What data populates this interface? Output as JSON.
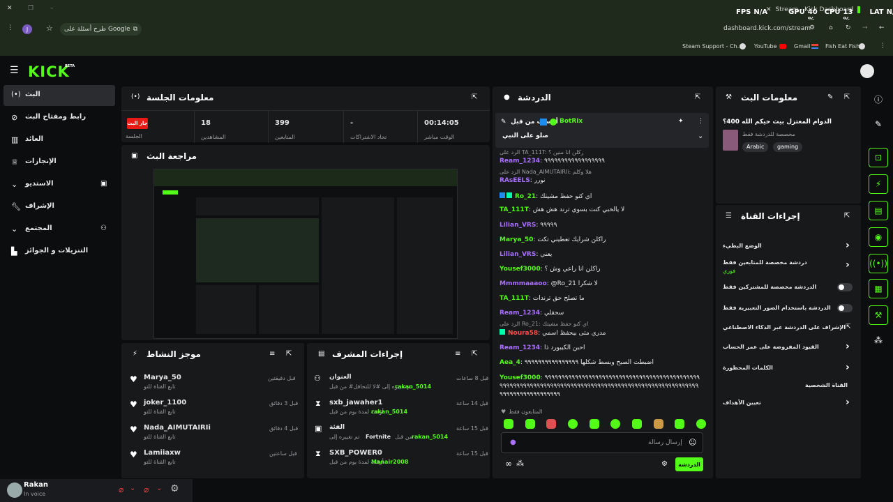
{
  "browser": {
    "tab_title": "Stream - Kick Dashboard",
    "overlay": {
      "fps_label": "FPS",
      "fps": "N/A",
      "gpu_label": "GPU",
      "gpu": "40 %",
      "cpu_label": "CPU",
      "cpu": "13 %",
      "lat_label": "LAT",
      "lat": "N/A"
    },
    "profile_initial": "J",
    "search_chip": "طرح أسئلة على Google",
    "url": "dashboard.kick.com/stream",
    "bookmarks": [
      "Steam Support - Ch...",
      "YouTube",
      "Gmail",
      "Fish Eat Fish"
    ]
  },
  "kick": {
    "logo": "KICK",
    "beta": "BETA"
  },
  "sidebar": {
    "items": [
      {
        "label": "البث",
        "icon": "broadcast-icon"
      },
      {
        "label": "رابط ومفتاح البث",
        "icon": "link-icon"
      },
      {
        "label": "العائد",
        "icon": "chart-icon"
      },
      {
        "label": "الإنجازات",
        "icon": "trophy-icon"
      },
      {
        "label": "الاستديو",
        "icon": "studio-icon"
      },
      {
        "label": "الإشراف",
        "icon": "wrench-icon"
      },
      {
        "label": "المجتمع",
        "icon": "community-icon"
      },
      {
        "label": "التنزيلات و الجوائز",
        "icon": "drops-icon"
      }
    ]
  },
  "session": {
    "title": "معلومات الجلسة",
    "live_badge": "جار البث",
    "live_label": "الجلسة",
    "stats": [
      {
        "value": "18",
        "label": "المشاهدين"
      },
      {
        "value": "399",
        "label": "المتابعين"
      },
      {
        "value": "-",
        "label": "تحاد الاشتراكات"
      },
      {
        "value": "00:14:05",
        "label": "الوقت مباشر"
      }
    ]
  },
  "preview": {
    "title": "مراجعة البث"
  },
  "activity": {
    "title": "موجز النشاط",
    "items": [
      {
        "name": "Marya_50",
        "sub": "تابع القناة للتو",
        "time": "قبل دقيقتين"
      },
      {
        "name": "joker_1100",
        "sub": "تابع القناة للتو",
        "time": "قبل 3 دقائق"
      },
      {
        "name": "Nada_AIMUTAIRIi",
        "sub": "تابع القناة للتو",
        "time": "قبل 4 دقائق"
      },
      {
        "name": "Lamiiaxw",
        "sub": "تابع القناة للتو",
        "time": "قبل ساعتين"
      }
    ]
  },
  "modactions": {
    "title": "إجراءات المشرف",
    "items": [
      {
        "title": "العنوان",
        "sub": "تم تغييره إلى #لا للتحاقل# من قبل",
        "user": "rakan_5014",
        "time": "قبل 8 ساعات"
      },
      {
        "title": "sxb_jawaher1",
        "sub": "أوقف لمدة يوم من قبل",
        "user": "rakan_5014",
        "time": "قبل 14 ساعة"
      },
      {
        "title": "الفئة",
        "sub": "تم تغييره إلى",
        "extra": "Fortnite",
        "sub2": "من قبل",
        "user": "rakan_5014",
        "time": "قبل 15 ساعة"
      },
      {
        "title": "SXB_POWER0",
        "sub": "أوقف لمدة يوم من قبل",
        "user": "Manair2008",
        "time": "قبل 15 ساعة"
      }
    ]
  },
  "chat": {
    "title": "الدردشة",
    "pinned_by": "أرسلت من قبل",
    "pinned_user": "BotRix",
    "pinned_msg": "صلو على النبي",
    "messages": [
      {
        "reply": "الرد على TA_111T: ركلن انا منين ؟",
        "user": "Ream_1234",
        "color": "purple",
        "text": "٩٩٩٩٩٩٩٩٩٩٩٩٩٩٩٩٩٩"
      },
      {
        "reply": "الرد على Nada_AIMUTAIRIi: هلا وكلم",
        "user": "RAsEELS",
        "color": "purple",
        "text": "نورر"
      },
      {
        "user": "Ro_21",
        "color": "green",
        "text": "اي كنو حفظ مشيتك"
      },
      {
        "user": "TA_111T",
        "color": "green",
        "text": "لا يالخبي كنت بسوي ترند هش هش"
      },
      {
        "user": "Lilian_VRS",
        "color": "purple",
        "text": "٩٩٩٩٩"
      },
      {
        "user": "Marya_50",
        "color": "green",
        "text": "راكلن شرايك تعطيني تكت"
      },
      {
        "user": "Lilian_VRS",
        "color": "purple",
        "text": "يعني"
      },
      {
        "user": "Yousef3000",
        "color": "green",
        "text": "راكلن انا راعي وش ؟"
      },
      {
        "user": "Mmmmaaaoo",
        "color": "purple",
        "text": "@Ro_21 لا شكرا"
      },
      {
        "user": "TA_111T",
        "color": "green",
        "text": "ما تصلح حق ترندات"
      },
      {
        "user": "Ream_1234",
        "color": "purple",
        "text": "سحقلي"
      },
      {
        "reply": "الرد على Ro_21: اي كنو حفظ مشيتك",
        "user": "Noura58",
        "color": "red",
        "text": "مدري متى بيحفظ اسمي"
      },
      {
        "user": "Ream_1234",
        "color": "purple",
        "text": "احبن الكيبورد ذا"
      },
      {
        "user": "Aea_4",
        "color": "green",
        "text": "اضبطت الصبح وبسط شكلها ٩٩٩٩٩٩٩٩٩٩٩٩٩٩٩٩"
      },
      {
        "user": "Yousef3000",
        "color": "green",
        "text": "٩٩٩٩٩٩٩٩٩٩٩٩٩٩٩٩٩٩٩٩٩٩٩٩٩٩٩٩٩٩٩٩٩٩٩٩٩٩٩٩٩٩٩٩٩٩٩٩٩٩٩٩٩٩٩٩٩٩٩٩٩٩٩٩٩٩٩٩٩٩٩٩٩٩٩٩٩٩٩٩٩٩٩٩٩٩٩٩٩٩٩٩٩٩٩٩٩٩٩٩٩٩٩٩٩٩٩٩٩٩٩٩٩٩٩٩٩٩٩٩٩٩٩"
      }
    ],
    "followers_only": "المتابعون فقط",
    "input_placeholder": "إرسال رسالة",
    "send_button": "الدردشة"
  },
  "streaminfo": {
    "title": "معلومات البث",
    "stream_title": "الدوام المعتزل بيث حيكم الله 400؟",
    "category": "مخصصة للدردشة فقط",
    "tags": [
      "Arabic",
      "gaming"
    ]
  },
  "channelactions": {
    "title": "إجراءات القناة",
    "items": [
      {
        "label": "الوضع البطيء",
        "type": "chev"
      },
      {
        "label": "دردشة مخصصة للمتابعين فقط",
        "sub": "فوري",
        "type": "chev"
      },
      {
        "label": "الدردشة مخصصة للمشتركين فقط",
        "type": "toggle"
      },
      {
        "label": "الدردشة باستخدام الصور التعبيرية فقط",
        "type": "toggle"
      },
      {
        "label": "الإشراف على الدردشة عبر الذكاء الاصطناعي",
        "type": "ext"
      },
      {
        "label": "القيود المفروضة على عمر الحساب",
        "type": "chev"
      },
      {
        "label": "الكلمات المحظورة",
        "type": "chev"
      }
    ],
    "personal_section": "القناة الشخصية",
    "goals": "تعيين الأهداف"
  },
  "discord": {
    "user": "Rakan",
    "status": "In voice"
  }
}
